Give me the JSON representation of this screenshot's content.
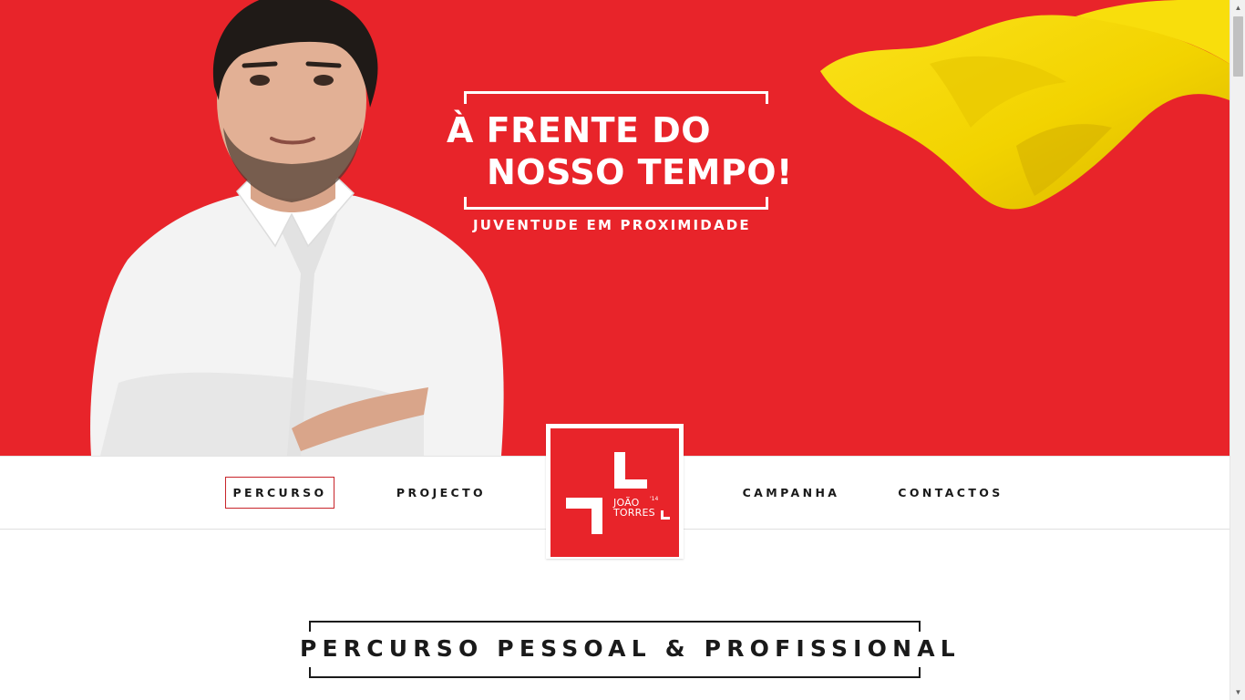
{
  "hero": {
    "headline_line1": "À FRENTE DO",
    "headline_line2": "NOSSO TEMPO!",
    "subline": "JUVENTUDE EM PROXIMIDADE",
    "background_color": "#e8242a",
    "accent_color": "#f5d800"
  },
  "nav": {
    "items": [
      {
        "label": "PERCURSO",
        "active": true
      },
      {
        "label": "PROJECTO",
        "active": false
      },
      {
        "label": "CAMPANHA",
        "active": false
      },
      {
        "label": "CONTACTOS",
        "active": false
      }
    ]
  },
  "logo": {
    "name_line1": "JOÃO",
    "name_line2": "TORRES",
    "year": "'14"
  },
  "section": {
    "title": "PERCURSO PESSOAL & PROFISSIONAL"
  }
}
